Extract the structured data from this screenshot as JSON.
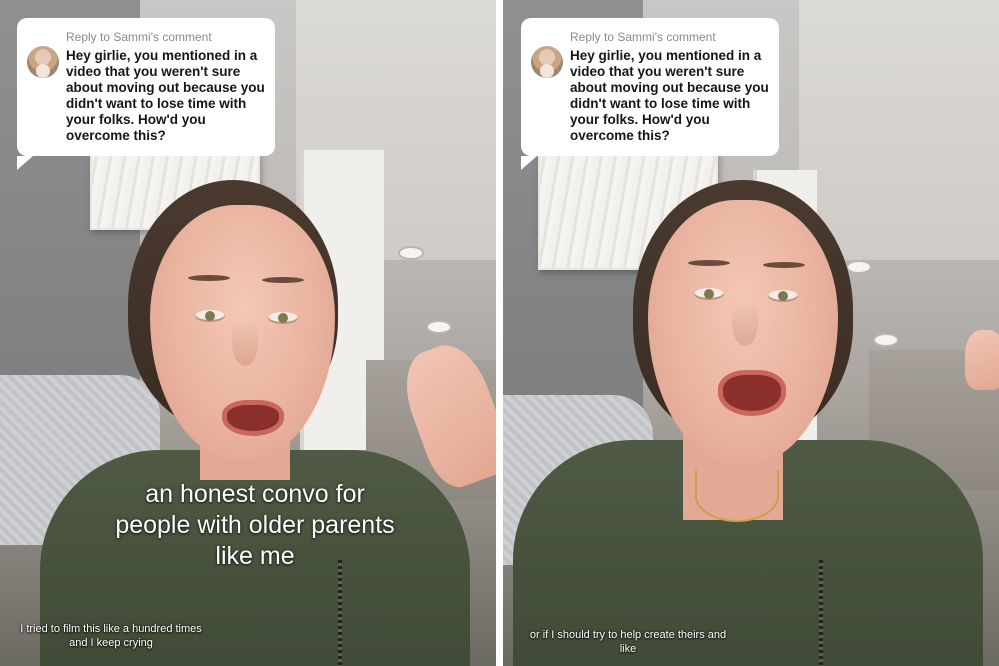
{
  "panels": [
    {
      "comment": {
        "reply_label": "Reply to Sammi's comment",
        "text": "Hey girlie, you mentioned in a video that you weren't sure about moving out because you didn't want to lose time with your folks. How'd you overcome this?"
      },
      "main_caption": "an honest convo for people with older parents like me",
      "sub_caption": "I tried to film this like a hundred times and I keep crying"
    },
    {
      "comment": {
        "reply_label": "Reply to Sammi's comment",
        "text": "Hey girlie, you mentioned in a video that you weren't sure about moving out because you didn't want to lose time with your folks. How'd you overcome this?"
      },
      "sub_caption": "or if I should try to help create theirs and like"
    }
  ],
  "colors": {
    "jacket": "#4f5a44",
    "bubble": "#ffffff",
    "caption_text": "#ffffff",
    "reply_label": "#8a8a8a"
  }
}
